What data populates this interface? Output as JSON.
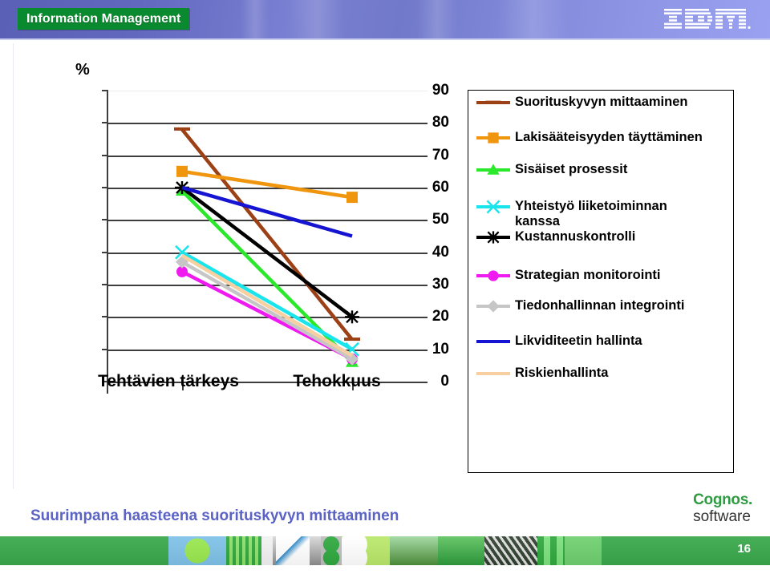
{
  "banner": {
    "brand_label": "Information Management",
    "logo_name": "IBM",
    "logo_mark": "ibm-logo"
  },
  "caption": "Suurimpana haasteena suorituskyvyn mittaaminen",
  "footer": {
    "vendor_line1": "Cognos.",
    "vendor_line2": "software",
    "page_number": "16"
  },
  "chart_data": {
    "type": "line",
    "title": "",
    "xlabel": "",
    "ylabel": "%",
    "ylim": [
      0,
      90
    ],
    "ytick_labels": [
      "90",
      "80",
      "70",
      "60",
      "50",
      "40",
      "30",
      "20",
      "10",
      "0"
    ],
    "yticks": [
      90,
      80,
      70,
      60,
      50,
      40,
      30,
      20,
      10,
      0
    ],
    "grid": true,
    "legend_position": "right",
    "categories": [
      "Tehtävien tärkeys",
      "Tehokkuus"
    ],
    "series": [
      {
        "name": "Suorituskyvyn mittaaminen",
        "values": [
          78,
          13
        ],
        "color": "#9c4016",
        "marker": "dash"
      },
      {
        "name": "Lakisääteisyyden täyttäminen",
        "values": [
          65,
          57
        ],
        "color": "#f0950e",
        "marker": "square"
      },
      {
        "name": "Sisäiset prosessit",
        "values": [
          59,
          6
        ],
        "color": "#2ae82a",
        "marker": "triangle"
      },
      {
        "name": "Yhteistyö liiketoiminnan kanssa",
        "values": [
          40,
          10
        ],
        "color": "#1ae5ec",
        "marker": "x"
      },
      {
        "name": "Kustannuskontrolli",
        "values": [
          60,
          20
        ],
        "color": "#000000",
        "marker": "star"
      },
      {
        "name": "Strategian monitorointi",
        "values": [
          34,
          7
        ],
        "color": "#ef1aef",
        "marker": "circle"
      },
      {
        "name": "Tiedonhallinnan integrointi",
        "values": [
          37,
          7
        ],
        "color": "#c6c6c6",
        "marker": "diamond"
      },
      {
        "name": "Likviditeetin hallinta",
        "values": [
          60,
          45
        ],
        "color": "#1414d2",
        "marker": "none"
      },
      {
        "name": "Riskienhallinta",
        "values": [
          39,
          8
        ],
        "color": "#f8cfa0",
        "marker": "none"
      }
    ]
  }
}
